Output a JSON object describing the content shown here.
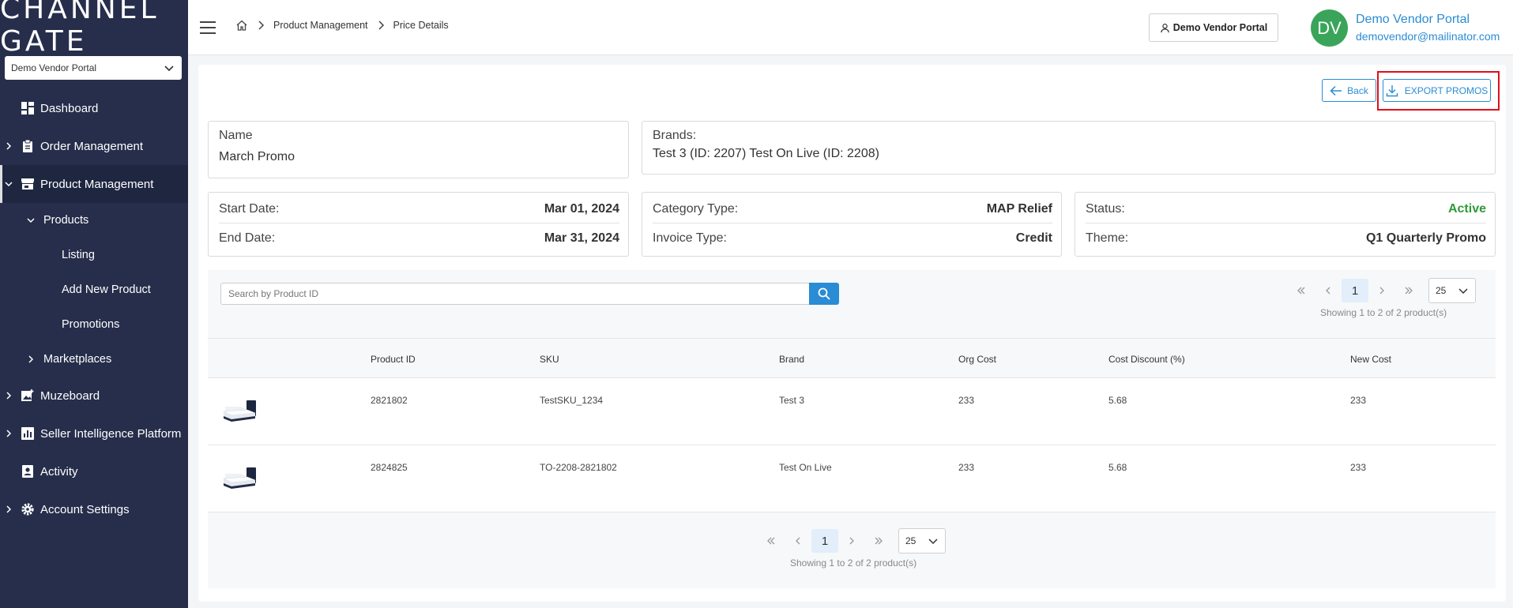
{
  "sidebar": {
    "logo": "CHANNEL GATE",
    "vendor_select": "Demo Vendor Portal",
    "items": [
      {
        "label": "Dashboard"
      },
      {
        "label": "Order Management"
      },
      {
        "label": "Product Management"
      },
      {
        "label": "Products"
      },
      {
        "label": "Listing"
      },
      {
        "label": "Add New Product"
      },
      {
        "label": "Promotions"
      },
      {
        "label": "Marketplaces"
      },
      {
        "label": "Muzeboard"
      },
      {
        "label": "Seller Intelligence Platform"
      },
      {
        "label": "Activity"
      },
      {
        "label": "Account Settings"
      }
    ]
  },
  "header": {
    "breadcrumb": [
      "Product Management",
      "Price Details"
    ],
    "vendor_button": "Demo Vendor Portal",
    "avatar": "DV",
    "user_name": "Demo Vendor Portal",
    "user_email": "demovendor@mailinator.com"
  },
  "actions": {
    "back": "Back",
    "export": "EXPORT PROMOS"
  },
  "details": {
    "name_label": "Name",
    "name_value": "March Promo",
    "brands_label": "Brands:",
    "brands_value": "Test 3 (ID: 2207)  Test On Live (ID: 2208)",
    "start_label": "Start Date:",
    "start_value": "Mar 01, 2024",
    "end_label": "End Date:",
    "end_value": "Mar 31, 2024",
    "category_label": "Category Type:",
    "category_value": "MAP Relief",
    "invoice_label": "Invoice Type:",
    "invoice_value": "Credit",
    "status_label": "Status:",
    "status_value": "Active",
    "theme_label": "Theme:",
    "theme_value": "Q1 Quarterly Promo"
  },
  "search": {
    "placeholder": "Search by Product ID"
  },
  "pagination": {
    "current": "1",
    "page_size": "25",
    "showing": "Showing 1 to 2 of 2 product(s)"
  },
  "table": {
    "columns": [
      "Product ID",
      "SKU",
      "Brand",
      "Org Cost",
      "Cost Discount (%)",
      "New Cost"
    ],
    "rows": [
      {
        "product_id": "2821802",
        "sku": "TestSKU_1234",
        "brand": "Test 3",
        "org_cost": "233",
        "discount": "5.68",
        "new_cost": "233"
      },
      {
        "product_id": "2824825",
        "sku": "TO-2208-2821802",
        "brand": "Test On Live",
        "org_cost": "233",
        "discount": "5.68",
        "new_cost": "233"
      }
    ]
  },
  "colors": {
    "sidebar": "#262e4b",
    "accent": "#2a8cd4",
    "active": "#2f9a37",
    "highlight": "#e0101a"
  }
}
